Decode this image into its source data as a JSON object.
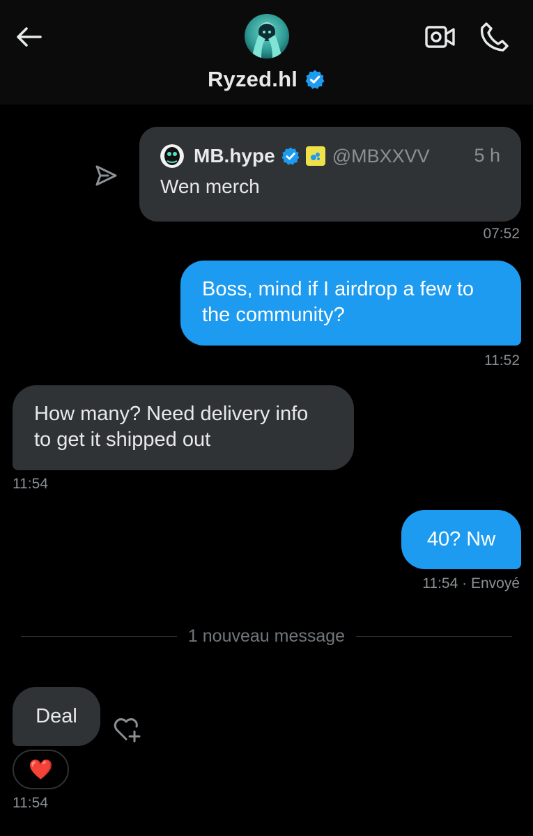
{
  "header": {
    "back_icon": "back-arrow-icon",
    "avatar_icon": "contact-avatar",
    "name": "Ryzed.hl",
    "verified_icon": "verified-badge-icon",
    "video_icon": "video-call-icon",
    "phone_icon": "phone-call-icon"
  },
  "shared_post": {
    "share_icon": "send-icon",
    "author_name": "MB.hype",
    "author_handle": "@MBXXVV",
    "age": "5 h",
    "text": "Wen merch",
    "timestamp": "07:52"
  },
  "messages": [
    {
      "from": "me",
      "text_line1": "Boss, mind if I airdrop a few to",
      "text_line2": "the community?",
      "time": "11:52"
    },
    {
      "from": "them",
      "text_line1": "How many? Need delivery info",
      "text_line2": "to get it shipped out",
      "time": "11:54"
    },
    {
      "from": "me",
      "text": "40? Nw",
      "time": "11:54",
      "status": "· Envoyé"
    }
  ],
  "divider": {
    "label": "1 nouveau message"
  },
  "last_message": {
    "text": "Deal",
    "reaction": "❤️",
    "add_reaction_icon": "heart-plus-icon",
    "time": "11:54"
  },
  "colors": {
    "background": "#000000",
    "header_bg": "#0B0B0B",
    "my_bubble": "#1D9BF0",
    "their_bubble": "#2F3336",
    "muted_text": "#8B9095",
    "verified": "#1D9BF0"
  }
}
